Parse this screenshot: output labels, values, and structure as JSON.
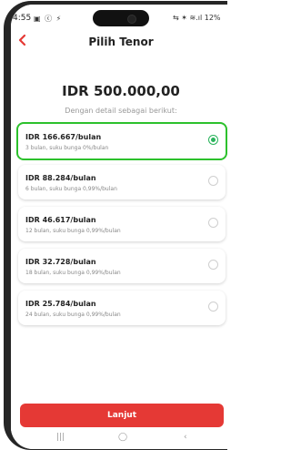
{
  "status_bar": {
    "time": "4:55",
    "notifications": "▣ ⓒ ⚡",
    "system": "⇆ ✶ ≋.ıl 12%"
  },
  "header": {
    "title": "Pilih Tenor"
  },
  "summary": {
    "amount": "IDR 500.000,00",
    "subtitle": "Dengan detail sebagai berikut:"
  },
  "tenor_options": [
    {
      "main": "IDR 166.667/bulan",
      "sub": "3 bulan, suku bunga 0%/bulan",
      "selected": true
    },
    {
      "main": "IDR 88.284/bulan",
      "sub": "6 bulan, suku bunga 0,99%/bulan",
      "selected": false
    },
    {
      "main": "IDR 46.617/bulan",
      "sub": "12 bulan, suku bunga 0,99%/bulan",
      "selected": false
    },
    {
      "main": "IDR 32.728/bulan",
      "sub": "18 bulan, suku bunga 0,99%/bulan",
      "selected": false
    },
    {
      "main": "IDR 25.784/bulan",
      "sub": "24 bulan, suku bunga 0,99%/bulan",
      "selected": false
    }
  ],
  "footer": {
    "cta_label": "Lanjut"
  },
  "colors": {
    "accent": "#e53935",
    "selected_border": "#2cc12c",
    "radio_on": "#29b35b"
  },
  "icons": {
    "back": "chevron-left-icon",
    "nav": [
      "recents-icon",
      "home-icon",
      "back-icon"
    ]
  }
}
